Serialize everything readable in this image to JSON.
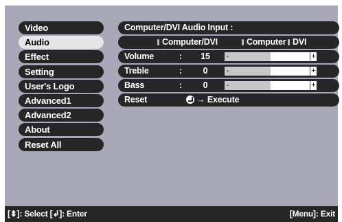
{
  "menu": {
    "items": [
      {
        "label": "Video",
        "selected": false
      },
      {
        "label": "Audio",
        "selected": true
      },
      {
        "label": "Effect",
        "selected": false
      },
      {
        "label": "Setting",
        "selected": false
      },
      {
        "label": "User's Logo",
        "selected": false
      },
      {
        "label": "Advanced1",
        "selected": false
      },
      {
        "label": "Advanced2",
        "selected": false
      },
      {
        "label": "About",
        "selected": false
      },
      {
        "label": "Reset All",
        "selected": false
      }
    ]
  },
  "panel": {
    "input_title": "Computer/DVI Audio Input :",
    "input_options": [
      "Computer/DVI",
      "Computer",
      "DVI"
    ],
    "selected_option": "Computer/DVI",
    "rows": [
      {
        "label": "Volume",
        "colon": ":",
        "value": "15",
        "level": 0.5
      },
      {
        "label": "Treble",
        "colon": ":",
        "value": "0",
        "level": 0.5
      },
      {
        "label": "Bass",
        "colon": ":",
        "value": "0",
        "level": 0.5
      }
    ],
    "reset": {
      "label": "Reset",
      "action": "Execute",
      "arrow": "→"
    },
    "minus": "-",
    "plus": "+"
  },
  "footer": {
    "left": "[⬍]: Select  [↲]: Enter",
    "right": "[Menu]: Exit"
  },
  "colors": {
    "background": "#a8a8b8",
    "item": "#262626",
    "selected": "#e6e6e6"
  }
}
